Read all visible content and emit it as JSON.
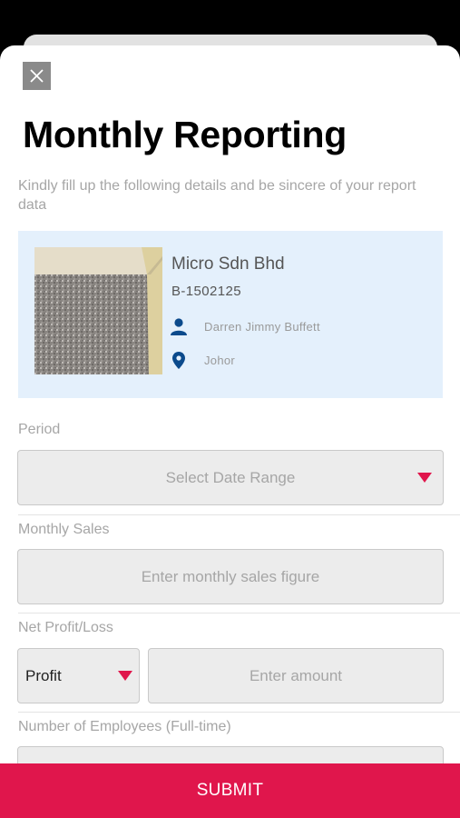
{
  "form": {
    "title": "Monthly Reporting",
    "subtitle": "Kindly fill up the following details and be sincere of your report data"
  },
  "business": {
    "name": "Micro Sdn Bhd",
    "reg_no": "B-1502125",
    "owner": "Darren Jimmy Buffett",
    "location": "Johor"
  },
  "fields": {
    "period": {
      "label": "Period",
      "placeholder": "Select Date Range"
    },
    "monthly_sales": {
      "label": "Monthly Sales",
      "placeholder": "Enter monthly sales figure"
    },
    "net_profit": {
      "label": "Net Profit/Loss",
      "type_value": "Profit",
      "placeholder": "Enter amount"
    },
    "employees": {
      "label": "Number of Employees (Full-time)"
    }
  },
  "submit_label": "SUBMIT",
  "colors": {
    "accent": "#e0164c",
    "card_bg": "#e4f0fc",
    "icon_blue": "#0b4a8c"
  }
}
